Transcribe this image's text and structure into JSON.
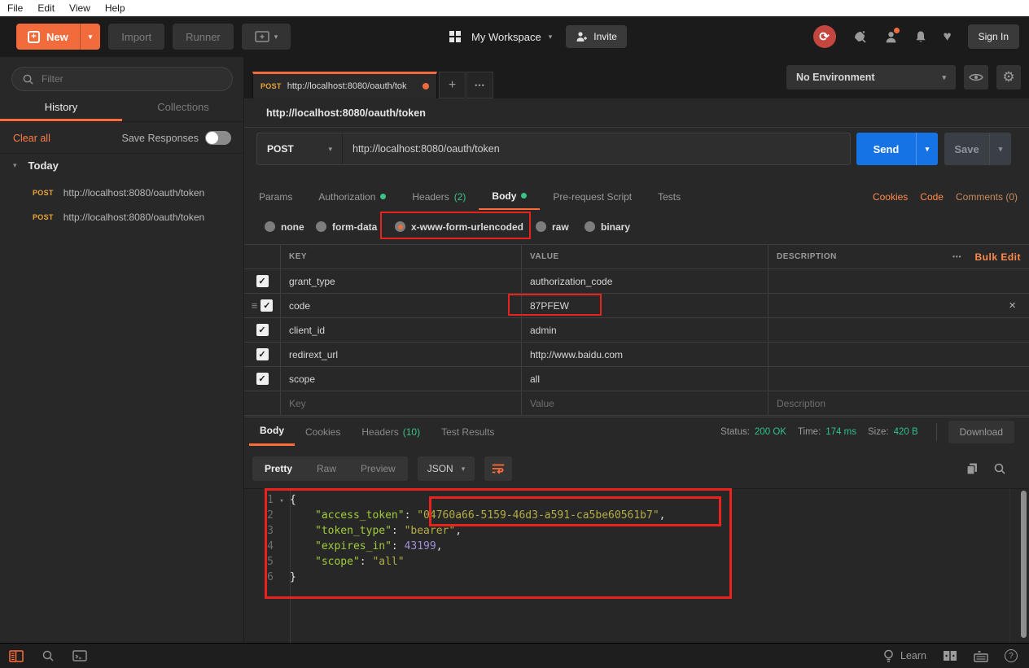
{
  "menu": {
    "file": "File",
    "edit": "Edit",
    "view": "View",
    "help": "Help"
  },
  "toolbar": {
    "new": "New",
    "import": "Import",
    "runner": "Runner",
    "workspace": "My Workspace",
    "invite": "Invite",
    "sign_in": "Sign In"
  },
  "sidebar": {
    "filter_placeholder": "Filter",
    "tab_history": "History",
    "tab_collections": "Collections",
    "clear_all": "Clear all",
    "save_responses": "Save Responses",
    "group": "Today",
    "items": [
      {
        "method": "POST",
        "url": "http://localhost:8080/oauth/token"
      },
      {
        "method": "POST",
        "url": "http://localhost:8080/oauth/token"
      }
    ]
  },
  "environment": {
    "name": "No Environment"
  },
  "request": {
    "tab_method": "POST",
    "tab_title": "http://localhost:8080/oauth/tok",
    "title": "http://localhost:8080/oauth/token",
    "method": "POST",
    "url": "http://localhost:8080/oauth/token",
    "send": "Send",
    "save": "Save",
    "tabs": {
      "params": "Params",
      "authorization": "Authorization",
      "headers": "Headers",
      "headers_count": "(2)",
      "body": "Body",
      "prerequest": "Pre-request Script",
      "tests": "Tests"
    },
    "links": {
      "cookies": "Cookies",
      "code": "Code",
      "comments": "Comments (0)"
    },
    "body_types": {
      "none": "none",
      "form_data": "form-data",
      "urlencoded": "x-www-form-urlencoded",
      "raw": "raw",
      "binary": "binary"
    }
  },
  "kv": {
    "headers": {
      "key": "KEY",
      "value": "VALUE",
      "description": "DESCRIPTION",
      "bulk_edit": "Bulk Edit"
    },
    "rows": [
      {
        "key": "grant_type",
        "value": "authorization_code"
      },
      {
        "key": "code",
        "value": "87PFEW"
      },
      {
        "key": "client_id",
        "value": "admin"
      },
      {
        "key": "redirext_url",
        "value": "http://www.baidu.com"
      },
      {
        "key": "scope",
        "value": "all"
      }
    ],
    "placeholder": {
      "key": "Key",
      "value": "Value",
      "description": "Description"
    }
  },
  "response": {
    "tabs": {
      "body": "Body",
      "cookies": "Cookies",
      "headers": "Headers",
      "headers_count": "(10)",
      "tests": "Test Results"
    },
    "meta": {
      "status_label": "Status:",
      "status": "200 OK",
      "time_label": "Time:",
      "time": "174 ms",
      "size_label": "Size:",
      "size": "420 B"
    },
    "download": "Download",
    "views": {
      "pretty": "Pretty",
      "raw": "Raw",
      "preview": "Preview"
    },
    "format": "JSON",
    "code": [
      {
        "n": "1",
        "text": "{"
      },
      {
        "n": "2",
        "key": "\"access_token\"",
        "sep": ": ",
        "str": "\"04760a66-5159-46d3-a591-ca5be60561b7\"",
        "end": ","
      },
      {
        "n": "3",
        "key": "\"token_type\"",
        "sep": ": ",
        "str": "\"bearer\"",
        "end": ","
      },
      {
        "n": "4",
        "key": "\"expires_in\"",
        "sep": ": ",
        "num": "43199",
        "end": ","
      },
      {
        "n": "5",
        "key": "\"scope\"",
        "sep": ": ",
        "str": "\"all\"",
        "end": ""
      },
      {
        "n": "6",
        "text": "}"
      }
    ]
  },
  "statusbar": {
    "learn": "Learn"
  },
  "icons": {
    "caret": "▾",
    "plus": "+",
    "more": "•••",
    "heart": "♥",
    "sync": "⟳",
    "check": "✓",
    "close": "×",
    "drag": "≡",
    "gear": "⚙",
    "fold": "▾",
    "help": "?"
  },
  "colors": {
    "accent": "#ff6c37",
    "green": "#3bc287",
    "blue": "#1673e6",
    "post_badge": "#eba439",
    "annotation": "#e8231d",
    "json_key": "#a0cc3a",
    "json_string": "#b3ad45",
    "json_number": "#a08fd8"
  }
}
